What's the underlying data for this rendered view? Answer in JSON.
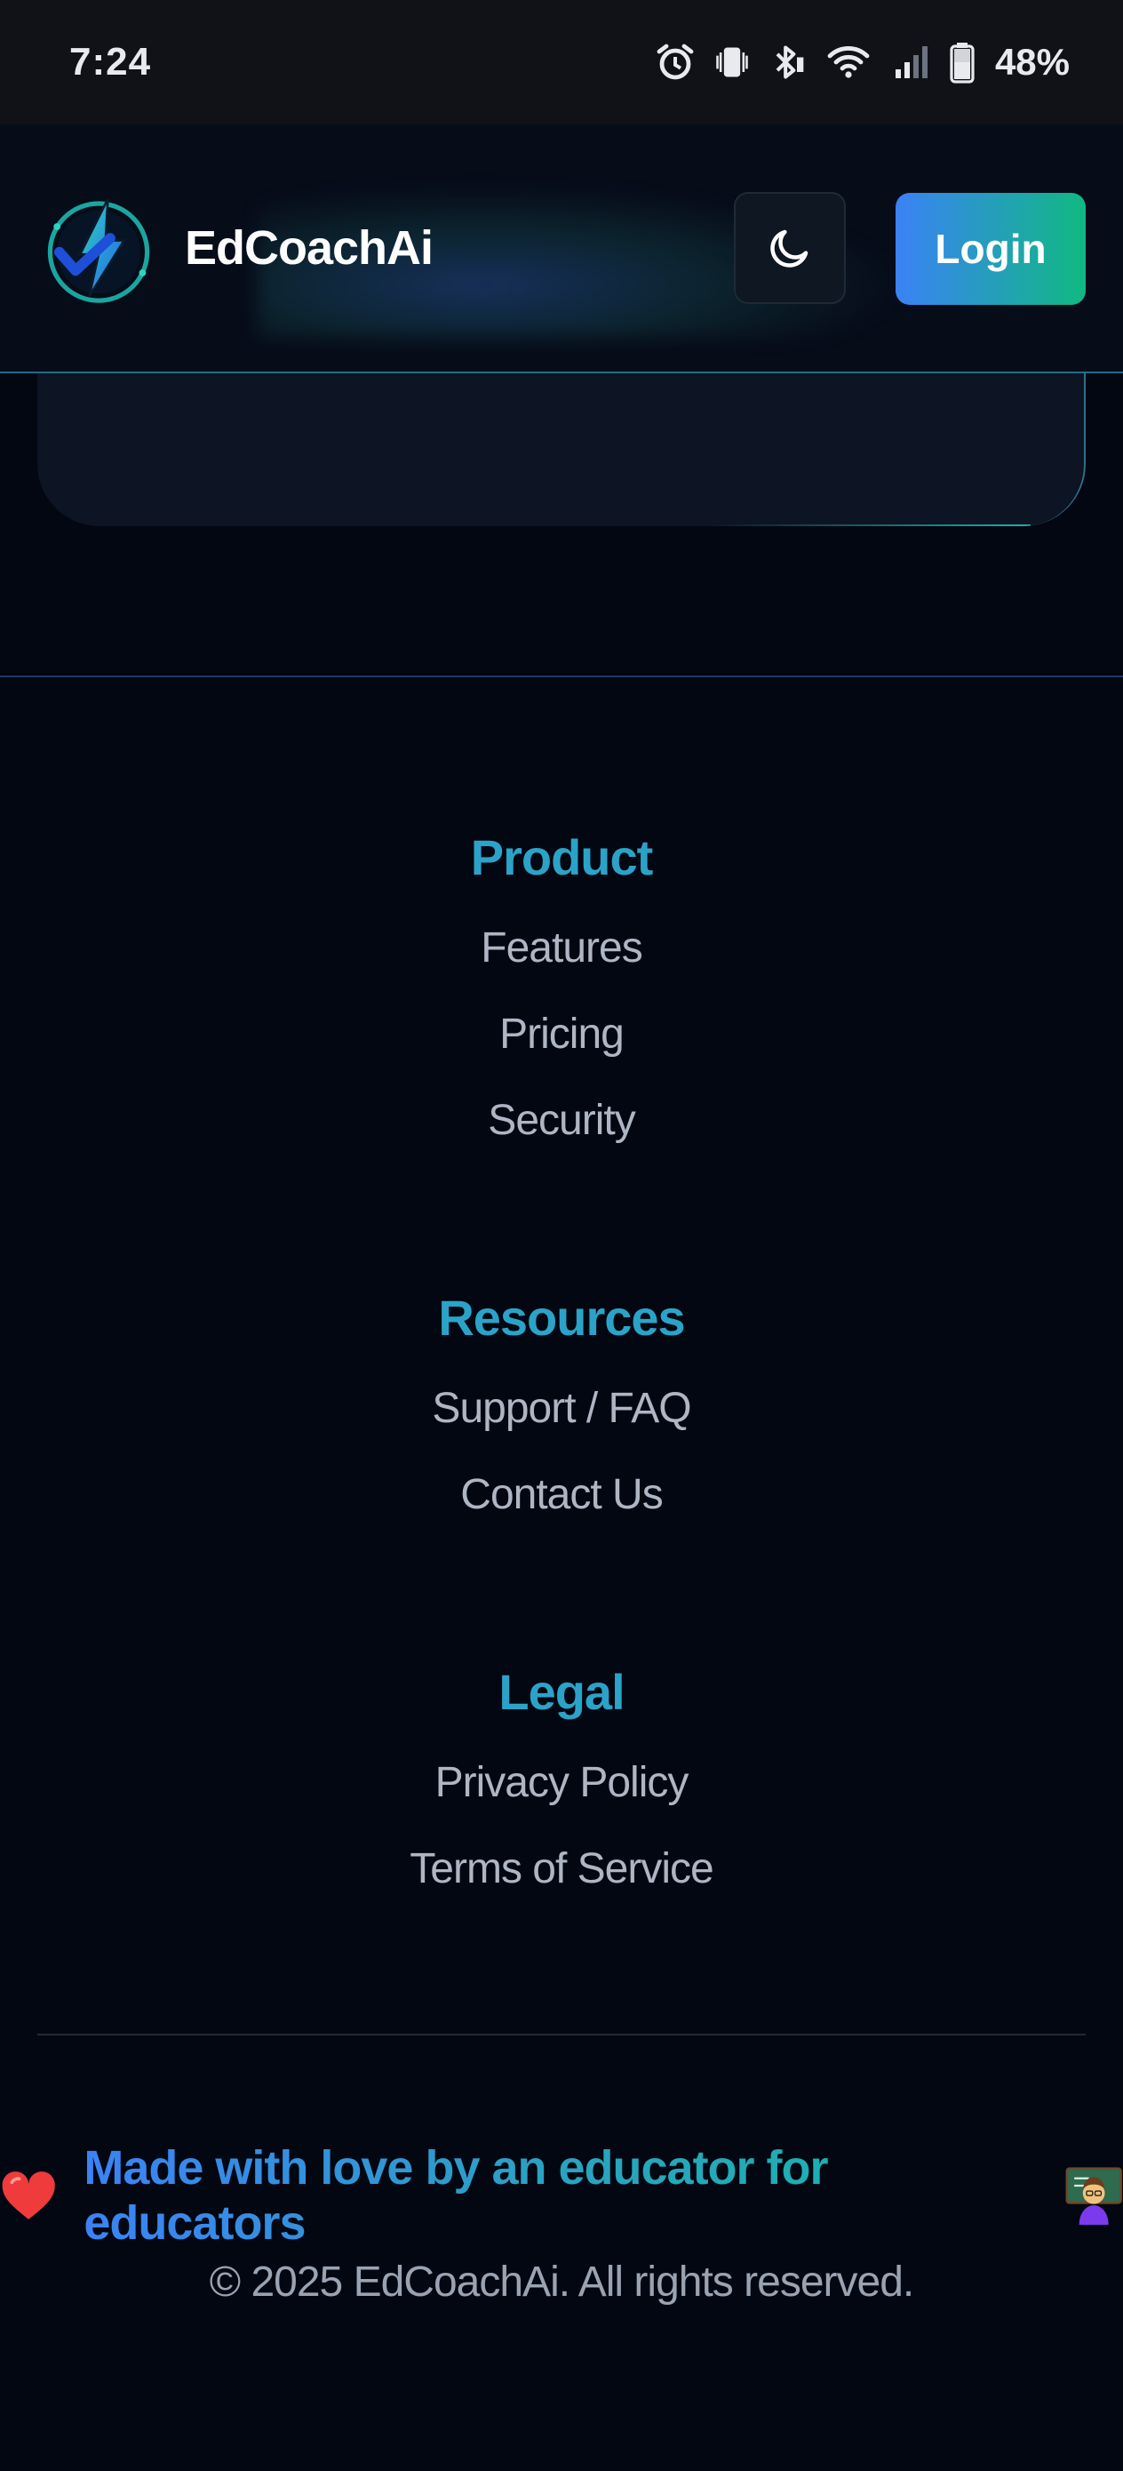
{
  "status_bar": {
    "time": "7:24",
    "battery": "48%",
    "icons": [
      "alarm-icon",
      "vibrate-icon",
      "bluetooth-icon",
      "wifi-icon",
      "signal-icon",
      "battery-icon"
    ]
  },
  "header": {
    "brand": "EdCoachAi",
    "theme_toggle_icon": "moon-icon",
    "login_label": "Login",
    "colors": {
      "accent_blue": "#3b82f6",
      "accent_green": "#10b981"
    }
  },
  "footer": {
    "sections": [
      {
        "heading": "Product",
        "links": [
          "Features",
          "Pricing",
          "Security"
        ]
      },
      {
        "heading": "Resources",
        "links": [
          "Support / FAQ",
          "Contact Us"
        ]
      },
      {
        "heading": "Legal",
        "links": [
          "Privacy Policy",
          "Terms of Service"
        ]
      }
    ],
    "tagline": "Made with love by an educator for educators",
    "tagline_icons": [
      "heart-icon",
      "teacher-icon"
    ],
    "copyright": "© 2025 EdCoachAi. All rights reserved."
  }
}
